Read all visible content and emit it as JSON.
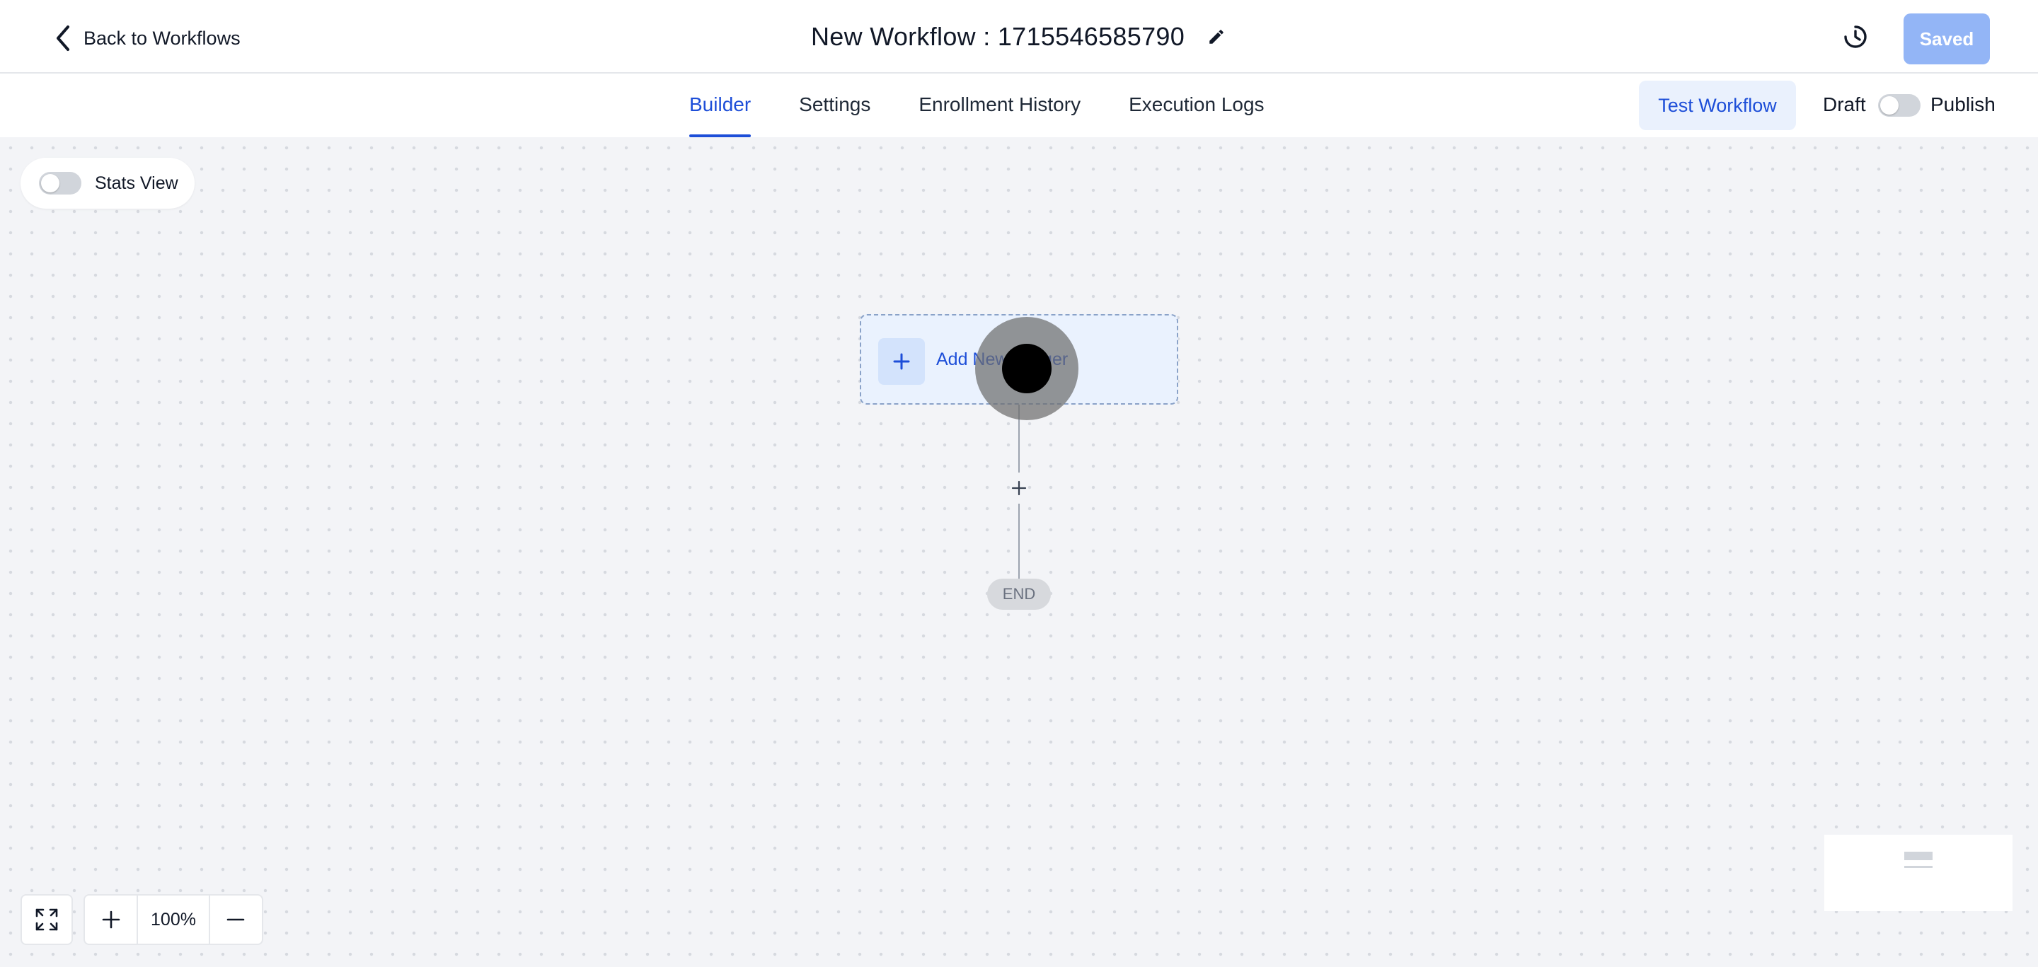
{
  "header": {
    "back_label": "Back to Workflows",
    "workflow_title": "New Workflow : 1715546585790",
    "saved_label": "Saved"
  },
  "tabs": [
    {
      "label": "Builder",
      "active": true
    },
    {
      "label": "Settings",
      "active": false
    },
    {
      "label": "Enrollment History",
      "active": false
    },
    {
      "label": "Execution Logs",
      "active": false
    }
  ],
  "actions": {
    "test_workflow_label": "Test Workflow",
    "draft_label": "Draft",
    "publish_label": "Publish",
    "publish_toggle_on": false
  },
  "canvas": {
    "stats_view_label": "Stats View",
    "stats_view_on": false,
    "trigger_label": "Add New Trigger",
    "end_label": "END",
    "zoom_level": "100%"
  },
  "icons": {
    "back": "chevron-left-icon",
    "edit": "pencil-icon",
    "history": "history-icon",
    "add": "plus-icon",
    "fit": "fullscreen-icon",
    "zoom_in": "plus-icon",
    "zoom_out": "minus-icon"
  },
  "colors": {
    "accent": "#1d4ed8",
    "saved_button": "#93b5f6",
    "test_button_bg": "#eaf1fd",
    "canvas_bg": "#f3f4f7",
    "trigger_bg": "#eaf2fe"
  }
}
